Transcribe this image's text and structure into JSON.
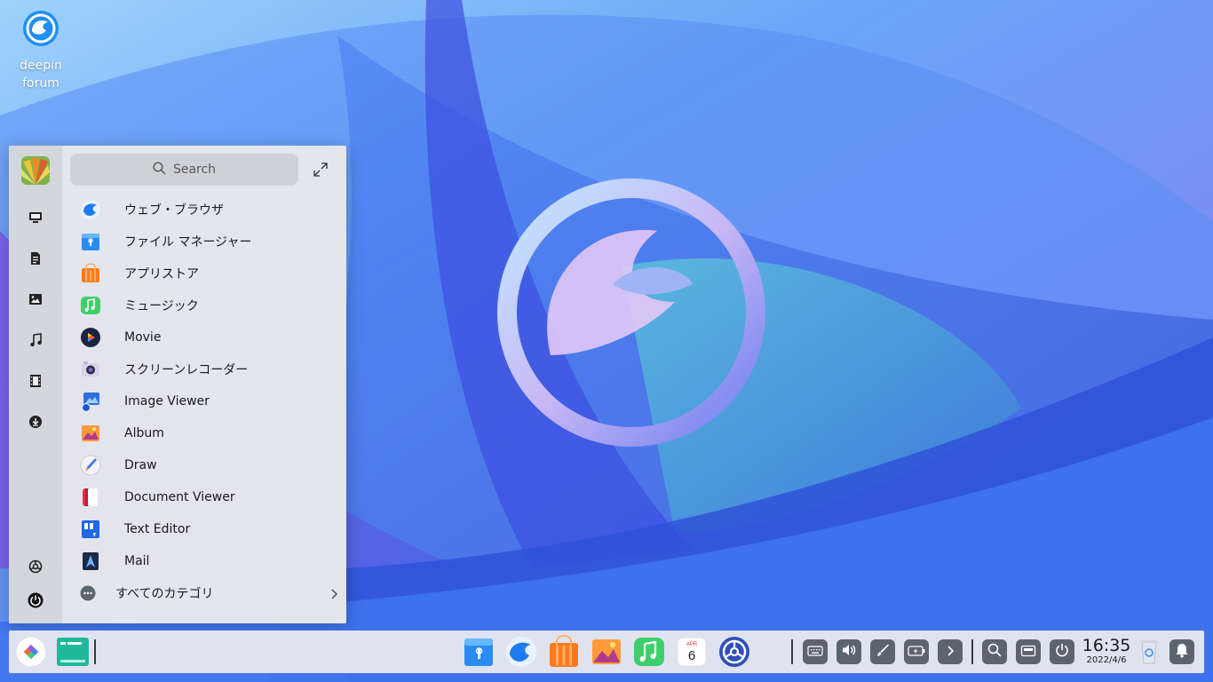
{
  "desktop": {
    "icons": [
      {
        "label": "deepin\nforum",
        "icon": "deepin-forum-icon"
      }
    ]
  },
  "launcher": {
    "search": {
      "placeholder": "Search"
    },
    "categories": [
      {
        "icon": "monitor-icon"
      },
      {
        "icon": "document-icon"
      },
      {
        "icon": "image-icon"
      },
      {
        "icon": "music-note-icon"
      },
      {
        "icon": "film-icon"
      },
      {
        "icon": "download-icon"
      }
    ],
    "bottom_buttons": [
      {
        "icon": "settings-icon"
      },
      {
        "icon": "power-icon"
      }
    ],
    "apps": [
      {
        "label": "ウェブ・ブラウザ",
        "icon": "web-browser-icon"
      },
      {
        "label": "ファイル マネージャー",
        "icon": "file-manager-icon"
      },
      {
        "label": "アプリストア",
        "icon": "app-store-icon"
      },
      {
        "label": "ミュージック",
        "icon": "music-icon"
      },
      {
        "label": "Movie",
        "icon": "movie-icon"
      },
      {
        "label": "スクリーンレコーダー",
        "icon": "screen-recorder-icon"
      },
      {
        "label": "Image Viewer",
        "icon": "image-viewer-icon"
      },
      {
        "label": "Album",
        "icon": "album-icon"
      },
      {
        "label": "Draw",
        "icon": "draw-icon"
      },
      {
        "label": "Document Viewer",
        "icon": "document-viewer-icon"
      },
      {
        "label": "Text Editor",
        "icon": "text-editor-icon"
      },
      {
        "label": "Mail",
        "icon": "mail-icon"
      }
    ],
    "all_categories_label": "すべてのカテゴリ"
  },
  "dock": {
    "apps": [
      {
        "icon": "file-manager-icon"
      },
      {
        "icon": "web-browser-icon"
      },
      {
        "icon": "app-store-icon"
      },
      {
        "icon": "album-icon"
      },
      {
        "icon": "music-icon"
      },
      {
        "icon": "calendar-icon",
        "month": "APR",
        "day": "6"
      },
      {
        "icon": "control-center-icon"
      }
    ],
    "tray": [
      {
        "icon": "keyboard-icon"
      },
      {
        "icon": "volume-icon"
      },
      {
        "icon": "brush-icon"
      },
      {
        "icon": "battery-icon"
      },
      {
        "icon": "chevron-right-icon"
      }
    ],
    "clock": {
      "time": "16:35",
      "date": "2022/4/6"
    }
  },
  "colors": {
    "accent": "#2a6df0",
    "launcher_bg": "#e8e8ec",
    "dock_bg": "#ececf0",
    "tray_button": "#5c6470"
  }
}
